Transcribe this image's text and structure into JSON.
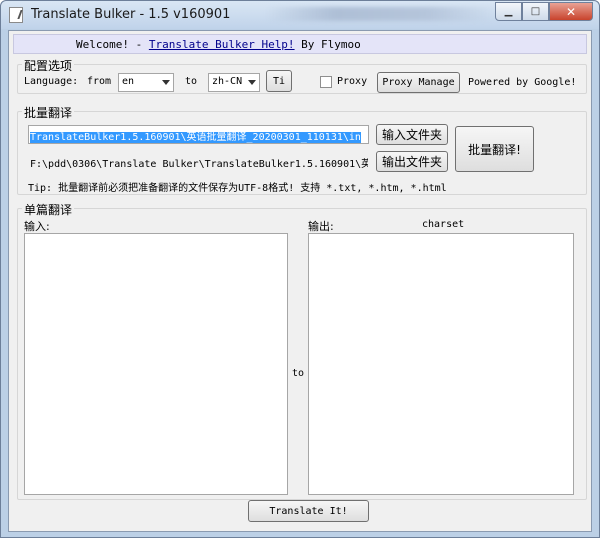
{
  "window": {
    "title": "Translate Bulker - 1.5 v160901"
  },
  "titlebar_buttons": {
    "minimize": "▁",
    "maximize": "□",
    "close": "✕"
  },
  "welcome": {
    "prefix": "Welcome! - ",
    "link": "Translate Bulker Help!",
    "suffix": " By Flymoo"
  },
  "config": {
    "title": "配置选项",
    "language_label": "Language:",
    "from_label": "from",
    "from_value": "en",
    "to_label": "to",
    "to_value": "zh-CN",
    "ti_button": "Ti",
    "proxy_label": "Proxy",
    "proxy_checked": false,
    "proxy_manage_button": "Proxy Manage",
    "powered_by": "Powered by Google!"
  },
  "batch": {
    "title": "批量翻译",
    "input_path": "TranslateBulker1.5.160901\\英语批量翻译_20200301_110131\\in",
    "input_button": "输入文件夹",
    "output_path": "F:\\pdd\\0306\\Translate Bulker\\TranslateBulker1.5.160901\\英",
    "output_button": "输出文件夹",
    "translate_button": "批量翻译!",
    "tip": "Tip: 批量翻译前必须把准备翻译的文件保存为UTF-8格式! 支持 *.txt, *.htm, *.html"
  },
  "single": {
    "title": "单篇翻译",
    "input_label": "输入:",
    "output_label": "输出:",
    "charset_label": "charset",
    "to_label": "to",
    "translate_button": "Translate It!"
  }
}
